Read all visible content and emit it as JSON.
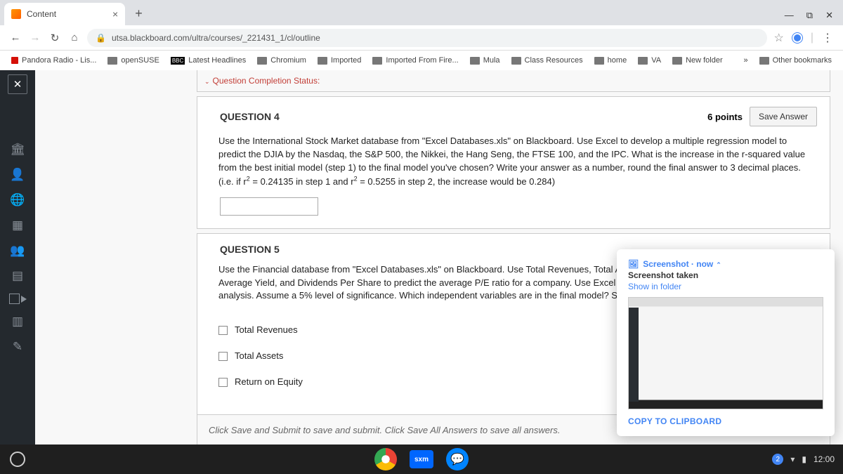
{
  "tab": {
    "title": "Content"
  },
  "url": "utsa.blackboard.com/ultra/courses/_221431_1/cl/outline",
  "bookmarks": {
    "pandora": "Pandora Radio - Lis...",
    "opensuse": "openSUSE",
    "latest": "Latest Headlines",
    "chromium": "Chromium",
    "imported": "Imported",
    "importedfire": "Imported From Fire...",
    "mula": "Mula",
    "classres": "Class Resources",
    "home": "home",
    "va": "VA",
    "newfolder": "New folder",
    "more": "»",
    "other": "Other bookmarks"
  },
  "status": {
    "label": "Question Completion Status:"
  },
  "q4": {
    "title": "QUESTION 4",
    "points": "6 points",
    "save": "Save Answer",
    "body1": "Use the International Stock Market database from \"Excel Databases.xls\" on Blackboard.  Use Excel to develop a multiple regression model to predict the DJIA by the Nasdaq, the S&P 500, the Nikkei, the Hang Seng, the FTSE 100, and the IPC.  What is the increase in the r-squared value from the best initial model (step 1) to the final model you've chosen?  Write your answer as a number, round the final answer to 3 decimal places.  (i.e.  if r",
    "body2": " = 0.24135 in step 1 and r",
    "body3": " = 0.5255 in step 2, the increase would be 0.284)"
  },
  "q5": {
    "title": "QUESTION 5",
    "body": "Use the Financial database from \"Excel Databases.xls\" on Blackboard.  Use Total Revenues, Total Assets, Return on Equity, Earnings Per Share, Average Yield, and Dividends Per Share to predict the average P/E ratio for a company.  Use Excel to perform a forward selection regression analysis.  Assume a 5% level of significance.  Which independent variables are in the final model?  Select all that apply.",
    "opt1": "Total Revenues",
    "opt2": "Total Assets",
    "opt3": "Return on Equity"
  },
  "footer": "Click Save and Submit to save and submit. Click Save All Answers to save all answers.",
  "popup": {
    "title": "Screenshot",
    "now": "now",
    "sub": "Screenshot taken",
    "show": "Show in folder",
    "copy": "COPY TO CLIPBOARD"
  },
  "shelf": {
    "sxm": "sxm",
    "badge": "2",
    "time": "12:00"
  }
}
